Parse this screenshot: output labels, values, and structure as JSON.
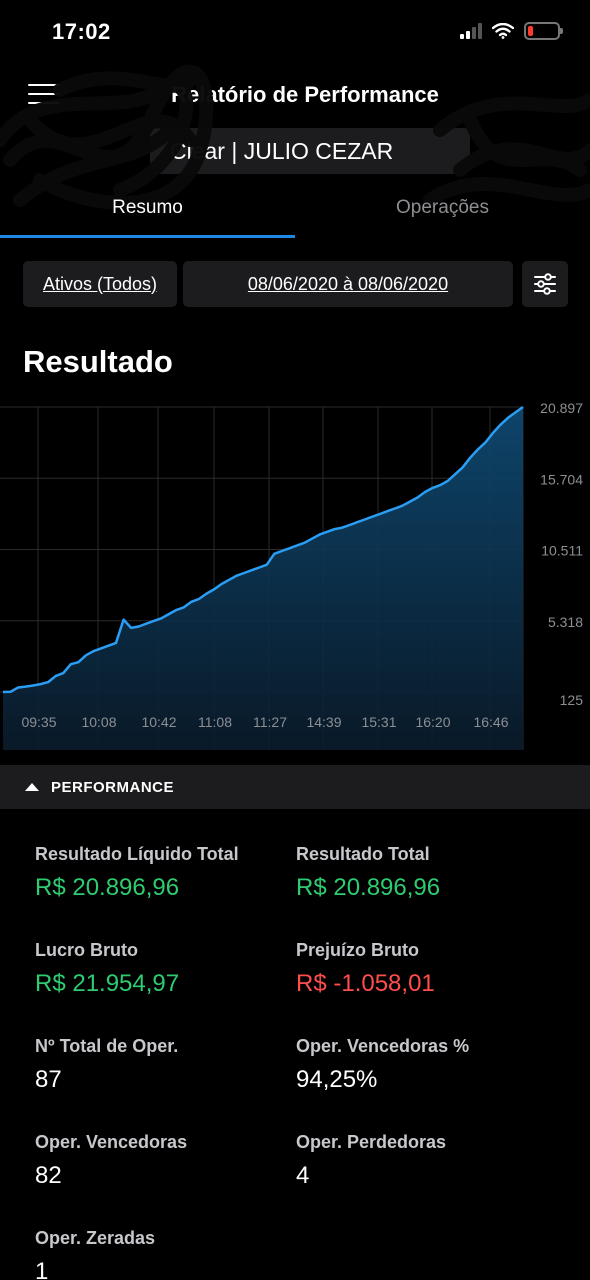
{
  "status_bar": {
    "time": "17:02"
  },
  "header": {
    "title": "Relatório de Performance",
    "account": "Clear | JULIO CEZAR"
  },
  "tabs": [
    {
      "label": "Resumo",
      "active": true
    },
    {
      "label": "Operações",
      "active": false
    }
  ],
  "filters": {
    "assets": "Ativos (Todos)",
    "date_range": "08/06/2020 à 08/06/2020"
  },
  "section_title": "Resultado",
  "chart_data": {
    "type": "area",
    "y_ticks": [
      "20.897",
      "15.704",
      "10.511",
      "5.318",
      "125"
    ],
    "x_ticks": [
      "09:35",
      "10:08",
      "10:42",
      "11:08",
      "11:27",
      "14:39",
      "15:31",
      "16:20",
      "16:46"
    ],
    "ylim": [
      125,
      20897
    ],
    "grid": true,
    "series": [
      {
        "values": [
          125,
          140,
          450,
          520,
          600,
          700,
          850,
          1300,
          1500,
          2150,
          2300,
          2800,
          3100,
          3300,
          3500,
          3700,
          5400,
          4800,
          4900,
          5100,
          5300,
          5500,
          5800,
          6100,
          6300,
          6700,
          6900,
          7300,
          7600,
          8000,
          8300,
          8600,
          8800,
          9000,
          9200,
          9400,
          10200,
          10400,
          10600,
          10800,
          11000,
          11300,
          11600,
          11800,
          12000,
          12100,
          12300,
          12500,
          12700,
          12900,
          13100,
          13300,
          13500,
          13700,
          14000,
          14300,
          14700,
          15000,
          15200,
          15500,
          16000,
          16500,
          17200,
          17800,
          18300,
          19000,
          19600,
          20100,
          20500,
          20897
        ]
      }
    ],
    "colors": {
      "line": "#2a9df4",
      "fill_top": "#0d3a5c",
      "grid": "#2a2a2a"
    }
  },
  "performance": {
    "header": "PERFORMANCE",
    "items": [
      {
        "label": "Resultado Líquido Total",
        "value": "R$ 20.896,96",
        "color": "green"
      },
      {
        "label": "Resultado Total",
        "value": "R$ 20.896,96",
        "color": "green"
      },
      {
        "label": "Lucro Bruto",
        "value": "R$ 21.954,97",
        "color": "green"
      },
      {
        "label": "Prejuízo Bruto",
        "value": "R$ -1.058,01",
        "color": "red"
      },
      {
        "label": "Nº Total de Oper.",
        "value": "87",
        "color": "white"
      },
      {
        "label": "Oper. Vencedoras %",
        "value": "94,25%",
        "color": "white"
      },
      {
        "label": "Oper. Vencedoras",
        "value": "82",
        "color": "white"
      },
      {
        "label": "Oper. Perdedoras",
        "value": "4",
        "color": "white"
      },
      {
        "label": "Oper. Zeradas",
        "value": "1",
        "color": "white"
      }
    ]
  }
}
